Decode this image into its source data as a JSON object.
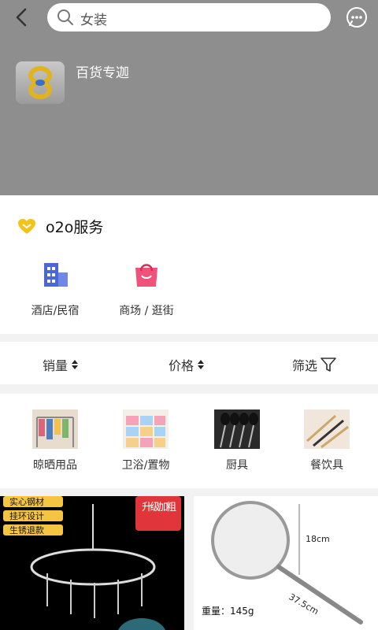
{
  "header": {
    "search_text": "女装",
    "shop_name": "百货专迦"
  },
  "o2o": {
    "title": "o2o服务",
    "services": [
      {
        "label": "酒店/民宿"
      },
      {
        "label": "商场 / 逛街"
      }
    ]
  },
  "sort": {
    "sales": "销量",
    "price": "价格",
    "filter": "筛选"
  },
  "categories": [
    {
      "label": "晾晒用品"
    },
    {
      "label": "卫浴/置物"
    },
    {
      "label": "厨具"
    },
    {
      "label": "餐饮具"
    }
  ],
  "products": [
    {
      "tags": [
        "实心钢材",
        "挂环设计",
        "生锈退款"
      ],
      "badge": "升级加粗"
    },
    {
      "height": "18cm",
      "length": "37.5cm",
      "weight": "重量：145g"
    }
  ],
  "colors": {
    "header_bg": "#8e8e8e",
    "heart": "#f0c419",
    "building": "#4a67d6",
    "bag": "#f0527a"
  }
}
